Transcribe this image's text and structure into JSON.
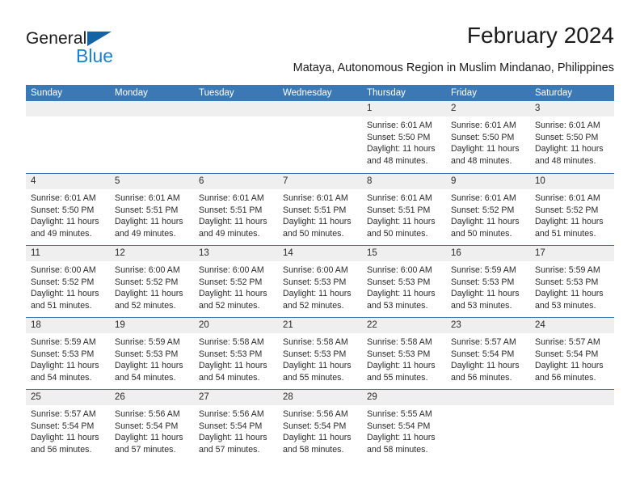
{
  "brand": {
    "name_dark": "General",
    "name_blue": "Blue",
    "accent_blue": "#1b7fd4",
    "triangle_blue": "#1464a5"
  },
  "header": {
    "title": "February 2024",
    "subtitle": "Mataya, Autonomous Region in Muslim Mindanao, Philippines"
  },
  "calendar": {
    "header_bg": "#3c78b4",
    "daynum_bg": "#efefef",
    "weekdays": [
      "Sunday",
      "Monday",
      "Tuesday",
      "Wednesday",
      "Thursday",
      "Friday",
      "Saturday"
    ],
    "weeks": [
      [
        {
          "day": "",
          "sunrise": "",
          "sunset": "",
          "daylight1": "",
          "daylight2": ""
        },
        {
          "day": "",
          "sunrise": "",
          "sunset": "",
          "daylight1": "",
          "daylight2": ""
        },
        {
          "day": "",
          "sunrise": "",
          "sunset": "",
          "daylight1": "",
          "daylight2": ""
        },
        {
          "day": "",
          "sunrise": "",
          "sunset": "",
          "daylight1": "",
          "daylight2": ""
        },
        {
          "day": "1",
          "sunrise": "Sunrise: 6:01 AM",
          "sunset": "Sunset: 5:50 PM",
          "daylight1": "Daylight: 11 hours",
          "daylight2": "and 48 minutes."
        },
        {
          "day": "2",
          "sunrise": "Sunrise: 6:01 AM",
          "sunset": "Sunset: 5:50 PM",
          "daylight1": "Daylight: 11 hours",
          "daylight2": "and 48 minutes."
        },
        {
          "day": "3",
          "sunrise": "Sunrise: 6:01 AM",
          "sunset": "Sunset: 5:50 PM",
          "daylight1": "Daylight: 11 hours",
          "daylight2": "and 48 minutes."
        }
      ],
      [
        {
          "day": "4",
          "sunrise": "Sunrise: 6:01 AM",
          "sunset": "Sunset: 5:50 PM",
          "daylight1": "Daylight: 11 hours",
          "daylight2": "and 49 minutes."
        },
        {
          "day": "5",
          "sunrise": "Sunrise: 6:01 AM",
          "sunset": "Sunset: 5:51 PM",
          "daylight1": "Daylight: 11 hours",
          "daylight2": "and 49 minutes."
        },
        {
          "day": "6",
          "sunrise": "Sunrise: 6:01 AM",
          "sunset": "Sunset: 5:51 PM",
          "daylight1": "Daylight: 11 hours",
          "daylight2": "and 49 minutes."
        },
        {
          "day": "7",
          "sunrise": "Sunrise: 6:01 AM",
          "sunset": "Sunset: 5:51 PM",
          "daylight1": "Daylight: 11 hours",
          "daylight2": "and 50 minutes."
        },
        {
          "day": "8",
          "sunrise": "Sunrise: 6:01 AM",
          "sunset": "Sunset: 5:51 PM",
          "daylight1": "Daylight: 11 hours",
          "daylight2": "and 50 minutes."
        },
        {
          "day": "9",
          "sunrise": "Sunrise: 6:01 AM",
          "sunset": "Sunset: 5:52 PM",
          "daylight1": "Daylight: 11 hours",
          "daylight2": "and 50 minutes."
        },
        {
          "day": "10",
          "sunrise": "Sunrise: 6:01 AM",
          "sunset": "Sunset: 5:52 PM",
          "daylight1": "Daylight: 11 hours",
          "daylight2": "and 51 minutes."
        }
      ],
      [
        {
          "day": "11",
          "sunrise": "Sunrise: 6:00 AM",
          "sunset": "Sunset: 5:52 PM",
          "daylight1": "Daylight: 11 hours",
          "daylight2": "and 51 minutes."
        },
        {
          "day": "12",
          "sunrise": "Sunrise: 6:00 AM",
          "sunset": "Sunset: 5:52 PM",
          "daylight1": "Daylight: 11 hours",
          "daylight2": "and 52 minutes."
        },
        {
          "day": "13",
          "sunrise": "Sunrise: 6:00 AM",
          "sunset": "Sunset: 5:52 PM",
          "daylight1": "Daylight: 11 hours",
          "daylight2": "and 52 minutes."
        },
        {
          "day": "14",
          "sunrise": "Sunrise: 6:00 AM",
          "sunset": "Sunset: 5:53 PM",
          "daylight1": "Daylight: 11 hours",
          "daylight2": "and 52 minutes."
        },
        {
          "day": "15",
          "sunrise": "Sunrise: 6:00 AM",
          "sunset": "Sunset: 5:53 PM",
          "daylight1": "Daylight: 11 hours",
          "daylight2": "and 53 minutes."
        },
        {
          "day": "16",
          "sunrise": "Sunrise: 5:59 AM",
          "sunset": "Sunset: 5:53 PM",
          "daylight1": "Daylight: 11 hours",
          "daylight2": "and 53 minutes."
        },
        {
          "day": "17",
          "sunrise": "Sunrise: 5:59 AM",
          "sunset": "Sunset: 5:53 PM",
          "daylight1": "Daylight: 11 hours",
          "daylight2": "and 53 minutes."
        }
      ],
      [
        {
          "day": "18",
          "sunrise": "Sunrise: 5:59 AM",
          "sunset": "Sunset: 5:53 PM",
          "daylight1": "Daylight: 11 hours",
          "daylight2": "and 54 minutes."
        },
        {
          "day": "19",
          "sunrise": "Sunrise: 5:59 AM",
          "sunset": "Sunset: 5:53 PM",
          "daylight1": "Daylight: 11 hours",
          "daylight2": "and 54 minutes."
        },
        {
          "day": "20",
          "sunrise": "Sunrise: 5:58 AM",
          "sunset": "Sunset: 5:53 PM",
          "daylight1": "Daylight: 11 hours",
          "daylight2": "and 54 minutes."
        },
        {
          "day": "21",
          "sunrise": "Sunrise: 5:58 AM",
          "sunset": "Sunset: 5:53 PM",
          "daylight1": "Daylight: 11 hours",
          "daylight2": "and 55 minutes."
        },
        {
          "day": "22",
          "sunrise": "Sunrise: 5:58 AM",
          "sunset": "Sunset: 5:53 PM",
          "daylight1": "Daylight: 11 hours",
          "daylight2": "and 55 minutes."
        },
        {
          "day": "23",
          "sunrise": "Sunrise: 5:57 AM",
          "sunset": "Sunset: 5:54 PM",
          "daylight1": "Daylight: 11 hours",
          "daylight2": "and 56 minutes."
        },
        {
          "day": "24",
          "sunrise": "Sunrise: 5:57 AM",
          "sunset": "Sunset: 5:54 PM",
          "daylight1": "Daylight: 11 hours",
          "daylight2": "and 56 minutes."
        }
      ],
      [
        {
          "day": "25",
          "sunrise": "Sunrise: 5:57 AM",
          "sunset": "Sunset: 5:54 PM",
          "daylight1": "Daylight: 11 hours",
          "daylight2": "and 56 minutes."
        },
        {
          "day": "26",
          "sunrise": "Sunrise: 5:56 AM",
          "sunset": "Sunset: 5:54 PM",
          "daylight1": "Daylight: 11 hours",
          "daylight2": "and 57 minutes."
        },
        {
          "day": "27",
          "sunrise": "Sunrise: 5:56 AM",
          "sunset": "Sunset: 5:54 PM",
          "daylight1": "Daylight: 11 hours",
          "daylight2": "and 57 minutes."
        },
        {
          "day": "28",
          "sunrise": "Sunrise: 5:56 AM",
          "sunset": "Sunset: 5:54 PM",
          "daylight1": "Daylight: 11 hours",
          "daylight2": "and 58 minutes."
        },
        {
          "day": "29",
          "sunrise": "Sunrise: 5:55 AM",
          "sunset": "Sunset: 5:54 PM",
          "daylight1": "Daylight: 11 hours",
          "daylight2": "and 58 minutes."
        },
        {
          "day": "",
          "sunrise": "",
          "sunset": "",
          "daylight1": "",
          "daylight2": ""
        },
        {
          "day": "",
          "sunrise": "",
          "sunset": "",
          "daylight1": "",
          "daylight2": ""
        }
      ]
    ]
  }
}
